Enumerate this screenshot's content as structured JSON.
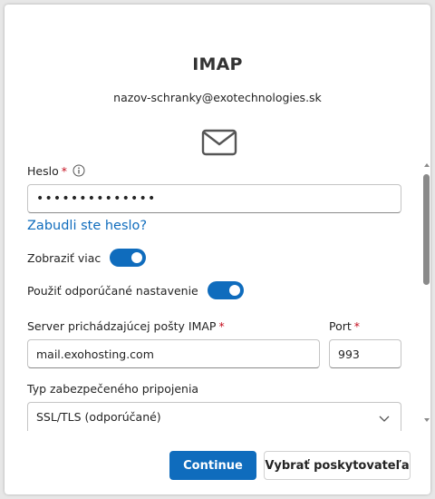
{
  "dialog": {
    "title": "IMAP",
    "email": "nazov-schranky@exotechnologies.sk",
    "icon": "mail-envelope-icon"
  },
  "password": {
    "label": "Heslo",
    "required_mark": "*",
    "value_masked": "••••••••••••••",
    "forgot_link": "Zabudli ste heslo?"
  },
  "toggles": {
    "show_more": {
      "label": "Zobraziť viac",
      "on": true
    },
    "recommended": {
      "label": "Použiť odporúčané nastavenie",
      "on": true
    }
  },
  "server": {
    "label": "Server prichádzajúcej pošty IMAP",
    "required_mark": "*",
    "value": "mail.exohosting.com"
  },
  "port": {
    "label": "Port",
    "required_mark": "*",
    "value": "993"
  },
  "security": {
    "label": "Typ zabezpečeného pripojenia",
    "selected": "SSL/TLS (odporúčané)"
  },
  "buttons": {
    "continue": "Continue",
    "choose_provider": "Vybrať poskytovateľa"
  },
  "colors": {
    "accent": "#0f6cbd",
    "required": "#c50f1f"
  }
}
